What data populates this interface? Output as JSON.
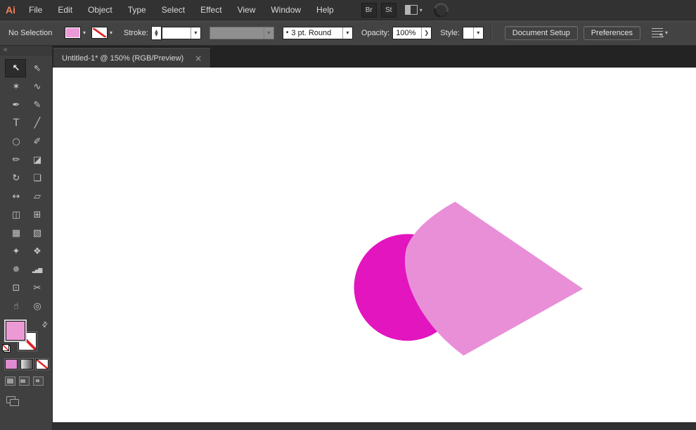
{
  "app": {
    "logo_text": "Ai"
  },
  "icons": {
    "chevron_down": "▾",
    "chevron_right": "❯",
    "spinner_up": "▲",
    "spinner_down": "▼",
    "swap": "⇄",
    "cursor": "↖",
    "brush_preview_dot": "•"
  },
  "menubar": {
    "items": [
      "File",
      "Edit",
      "Object",
      "Type",
      "Select",
      "Effect",
      "View",
      "Window",
      "Help"
    ],
    "bridge": "Br",
    "stock": "St"
  },
  "control_bar": {
    "selection_status": "No Selection",
    "stroke_label": "Stroke:",
    "brush_style": "3 pt. Round",
    "opacity_label": "Opacity:",
    "opacity_value": "100%",
    "style_label": "Style:",
    "document_setup_button": "Document Setup",
    "preferences_button": "Preferences"
  },
  "document_tab": {
    "title": "Untitled-1* @ 150% (RGB/Preview)",
    "close_glyph": "×"
  },
  "toolbar": {
    "collapse_glyph": "«",
    "tools": [
      {
        "name": "selection-tool",
        "glyph": "↖",
        "selected": true
      },
      {
        "name": "direct-selection-tool",
        "glyph": "⇖"
      },
      {
        "name": "magic-wand-tool",
        "glyph": "✶"
      },
      {
        "name": "lasso-tool",
        "glyph": "∿"
      },
      {
        "name": "pen-tool",
        "glyph": "✒"
      },
      {
        "name": "curvature-tool",
        "glyph": "✎"
      },
      {
        "name": "type-tool",
        "glyph": "T"
      },
      {
        "name": "line-segment-tool",
        "glyph": "╱"
      },
      {
        "name": "ellipse-tool",
        "glyph": "○"
      },
      {
        "name": "paintbrush-tool",
        "glyph": "✐"
      },
      {
        "name": "pencil-tool",
        "glyph": "✏"
      },
      {
        "name": "eraser-tool",
        "glyph": "◪"
      },
      {
        "name": "rotate-tool",
        "glyph": "↻"
      },
      {
        "name": "scale-tool",
        "glyph": "❏"
      },
      {
        "name": "width-tool",
        "glyph": "↔"
      },
      {
        "name": "free-transform-tool",
        "glyph": "▱"
      },
      {
        "name": "shape-builder-tool",
        "glyph": "◫"
      },
      {
        "name": "perspective-grid-tool",
        "glyph": "⊞"
      },
      {
        "name": "mesh-tool",
        "glyph": "▦"
      },
      {
        "name": "gradient-tool",
        "glyph": "▧"
      },
      {
        "name": "eyedropper-tool",
        "glyph": "✦"
      },
      {
        "name": "blend-tool",
        "glyph": "❖"
      },
      {
        "name": "symbol-sprayer-tool",
        "glyph": "✵"
      },
      {
        "name": "column-graph-tool",
        "glyph": "▂▄▆"
      },
      {
        "name": "artboard-tool",
        "glyph": "⊡"
      },
      {
        "name": "slice-tool",
        "glyph": "✂"
      },
      {
        "name": "hand-tool",
        "glyph": "☝"
      },
      {
        "name": "zoom-tool",
        "glyph": "◎"
      }
    ]
  },
  "colors": {
    "logo": "#f4825a",
    "fill_swatch": "#ec9ad6",
    "color_button": "#e08ad0",
    "circle_fill": "#e215bf",
    "blob_fill": "#e98fd8"
  }
}
